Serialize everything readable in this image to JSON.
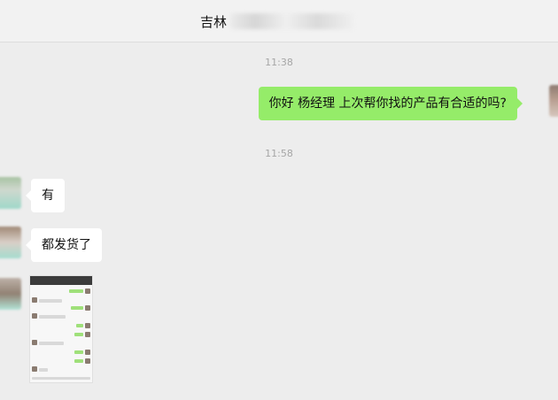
{
  "header": {
    "title_prefix": "吉林",
    "title_suffix": ""
  },
  "messages": [
    {
      "type": "timestamp",
      "text": "11:38"
    },
    {
      "type": "outgoing",
      "text": "你好 杨经理 上次帮你找的产品有合适的吗?"
    },
    {
      "type": "timestamp",
      "text": "11:58"
    },
    {
      "type": "incoming",
      "text": "有"
    },
    {
      "type": "incoming",
      "text": "都发货了"
    },
    {
      "type": "incoming-image",
      "text": ""
    }
  ],
  "colors": {
    "outgoing_bubble": "#95ec69",
    "incoming_bubble": "#ffffff",
    "background": "#ededed"
  }
}
